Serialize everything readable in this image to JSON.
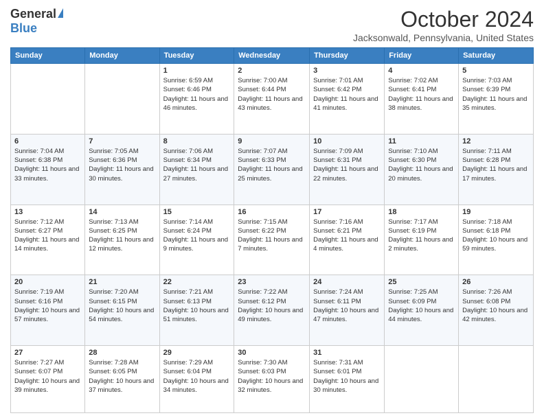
{
  "logo": {
    "general": "General",
    "blue": "Blue"
  },
  "header": {
    "month_title": "October 2024",
    "location": "Jacksonwald, Pennsylvania, United States"
  },
  "days_of_week": [
    "Sunday",
    "Monday",
    "Tuesday",
    "Wednesday",
    "Thursday",
    "Friday",
    "Saturday"
  ],
  "weeks": [
    [
      {
        "day": "",
        "sunrise": "",
        "sunset": "",
        "daylight": ""
      },
      {
        "day": "",
        "sunrise": "",
        "sunset": "",
        "daylight": ""
      },
      {
        "day": "1",
        "sunrise": "Sunrise: 6:59 AM",
        "sunset": "Sunset: 6:46 PM",
        "daylight": "Daylight: 11 hours and 46 minutes."
      },
      {
        "day": "2",
        "sunrise": "Sunrise: 7:00 AM",
        "sunset": "Sunset: 6:44 PM",
        "daylight": "Daylight: 11 hours and 43 minutes."
      },
      {
        "day": "3",
        "sunrise": "Sunrise: 7:01 AM",
        "sunset": "Sunset: 6:42 PM",
        "daylight": "Daylight: 11 hours and 41 minutes."
      },
      {
        "day": "4",
        "sunrise": "Sunrise: 7:02 AM",
        "sunset": "Sunset: 6:41 PM",
        "daylight": "Daylight: 11 hours and 38 minutes."
      },
      {
        "day": "5",
        "sunrise": "Sunrise: 7:03 AM",
        "sunset": "Sunset: 6:39 PM",
        "daylight": "Daylight: 11 hours and 35 minutes."
      }
    ],
    [
      {
        "day": "6",
        "sunrise": "Sunrise: 7:04 AM",
        "sunset": "Sunset: 6:38 PM",
        "daylight": "Daylight: 11 hours and 33 minutes."
      },
      {
        "day": "7",
        "sunrise": "Sunrise: 7:05 AM",
        "sunset": "Sunset: 6:36 PM",
        "daylight": "Daylight: 11 hours and 30 minutes."
      },
      {
        "day": "8",
        "sunrise": "Sunrise: 7:06 AM",
        "sunset": "Sunset: 6:34 PM",
        "daylight": "Daylight: 11 hours and 27 minutes."
      },
      {
        "day": "9",
        "sunrise": "Sunrise: 7:07 AM",
        "sunset": "Sunset: 6:33 PM",
        "daylight": "Daylight: 11 hours and 25 minutes."
      },
      {
        "day": "10",
        "sunrise": "Sunrise: 7:09 AM",
        "sunset": "Sunset: 6:31 PM",
        "daylight": "Daylight: 11 hours and 22 minutes."
      },
      {
        "day": "11",
        "sunrise": "Sunrise: 7:10 AM",
        "sunset": "Sunset: 6:30 PM",
        "daylight": "Daylight: 11 hours and 20 minutes."
      },
      {
        "day": "12",
        "sunrise": "Sunrise: 7:11 AM",
        "sunset": "Sunset: 6:28 PM",
        "daylight": "Daylight: 11 hours and 17 minutes."
      }
    ],
    [
      {
        "day": "13",
        "sunrise": "Sunrise: 7:12 AM",
        "sunset": "Sunset: 6:27 PM",
        "daylight": "Daylight: 11 hours and 14 minutes."
      },
      {
        "day": "14",
        "sunrise": "Sunrise: 7:13 AM",
        "sunset": "Sunset: 6:25 PM",
        "daylight": "Daylight: 11 hours and 12 minutes."
      },
      {
        "day": "15",
        "sunrise": "Sunrise: 7:14 AM",
        "sunset": "Sunset: 6:24 PM",
        "daylight": "Daylight: 11 hours and 9 minutes."
      },
      {
        "day": "16",
        "sunrise": "Sunrise: 7:15 AM",
        "sunset": "Sunset: 6:22 PM",
        "daylight": "Daylight: 11 hours and 7 minutes."
      },
      {
        "day": "17",
        "sunrise": "Sunrise: 7:16 AM",
        "sunset": "Sunset: 6:21 PM",
        "daylight": "Daylight: 11 hours and 4 minutes."
      },
      {
        "day": "18",
        "sunrise": "Sunrise: 7:17 AM",
        "sunset": "Sunset: 6:19 PM",
        "daylight": "Daylight: 11 hours and 2 minutes."
      },
      {
        "day": "19",
        "sunrise": "Sunrise: 7:18 AM",
        "sunset": "Sunset: 6:18 PM",
        "daylight": "Daylight: 10 hours and 59 minutes."
      }
    ],
    [
      {
        "day": "20",
        "sunrise": "Sunrise: 7:19 AM",
        "sunset": "Sunset: 6:16 PM",
        "daylight": "Daylight: 10 hours and 57 minutes."
      },
      {
        "day": "21",
        "sunrise": "Sunrise: 7:20 AM",
        "sunset": "Sunset: 6:15 PM",
        "daylight": "Daylight: 10 hours and 54 minutes."
      },
      {
        "day": "22",
        "sunrise": "Sunrise: 7:21 AM",
        "sunset": "Sunset: 6:13 PM",
        "daylight": "Daylight: 10 hours and 51 minutes."
      },
      {
        "day": "23",
        "sunrise": "Sunrise: 7:22 AM",
        "sunset": "Sunset: 6:12 PM",
        "daylight": "Daylight: 10 hours and 49 minutes."
      },
      {
        "day": "24",
        "sunrise": "Sunrise: 7:24 AM",
        "sunset": "Sunset: 6:11 PM",
        "daylight": "Daylight: 10 hours and 47 minutes."
      },
      {
        "day": "25",
        "sunrise": "Sunrise: 7:25 AM",
        "sunset": "Sunset: 6:09 PM",
        "daylight": "Daylight: 10 hours and 44 minutes."
      },
      {
        "day": "26",
        "sunrise": "Sunrise: 7:26 AM",
        "sunset": "Sunset: 6:08 PM",
        "daylight": "Daylight: 10 hours and 42 minutes."
      }
    ],
    [
      {
        "day": "27",
        "sunrise": "Sunrise: 7:27 AM",
        "sunset": "Sunset: 6:07 PM",
        "daylight": "Daylight: 10 hours and 39 minutes."
      },
      {
        "day": "28",
        "sunrise": "Sunrise: 7:28 AM",
        "sunset": "Sunset: 6:05 PM",
        "daylight": "Daylight: 10 hours and 37 minutes."
      },
      {
        "day": "29",
        "sunrise": "Sunrise: 7:29 AM",
        "sunset": "Sunset: 6:04 PM",
        "daylight": "Daylight: 10 hours and 34 minutes."
      },
      {
        "day": "30",
        "sunrise": "Sunrise: 7:30 AM",
        "sunset": "Sunset: 6:03 PM",
        "daylight": "Daylight: 10 hours and 32 minutes."
      },
      {
        "day": "31",
        "sunrise": "Sunrise: 7:31 AM",
        "sunset": "Sunset: 6:01 PM",
        "daylight": "Daylight: 10 hours and 30 minutes."
      },
      {
        "day": "",
        "sunrise": "",
        "sunset": "",
        "daylight": ""
      },
      {
        "day": "",
        "sunrise": "",
        "sunset": "",
        "daylight": ""
      }
    ]
  ]
}
